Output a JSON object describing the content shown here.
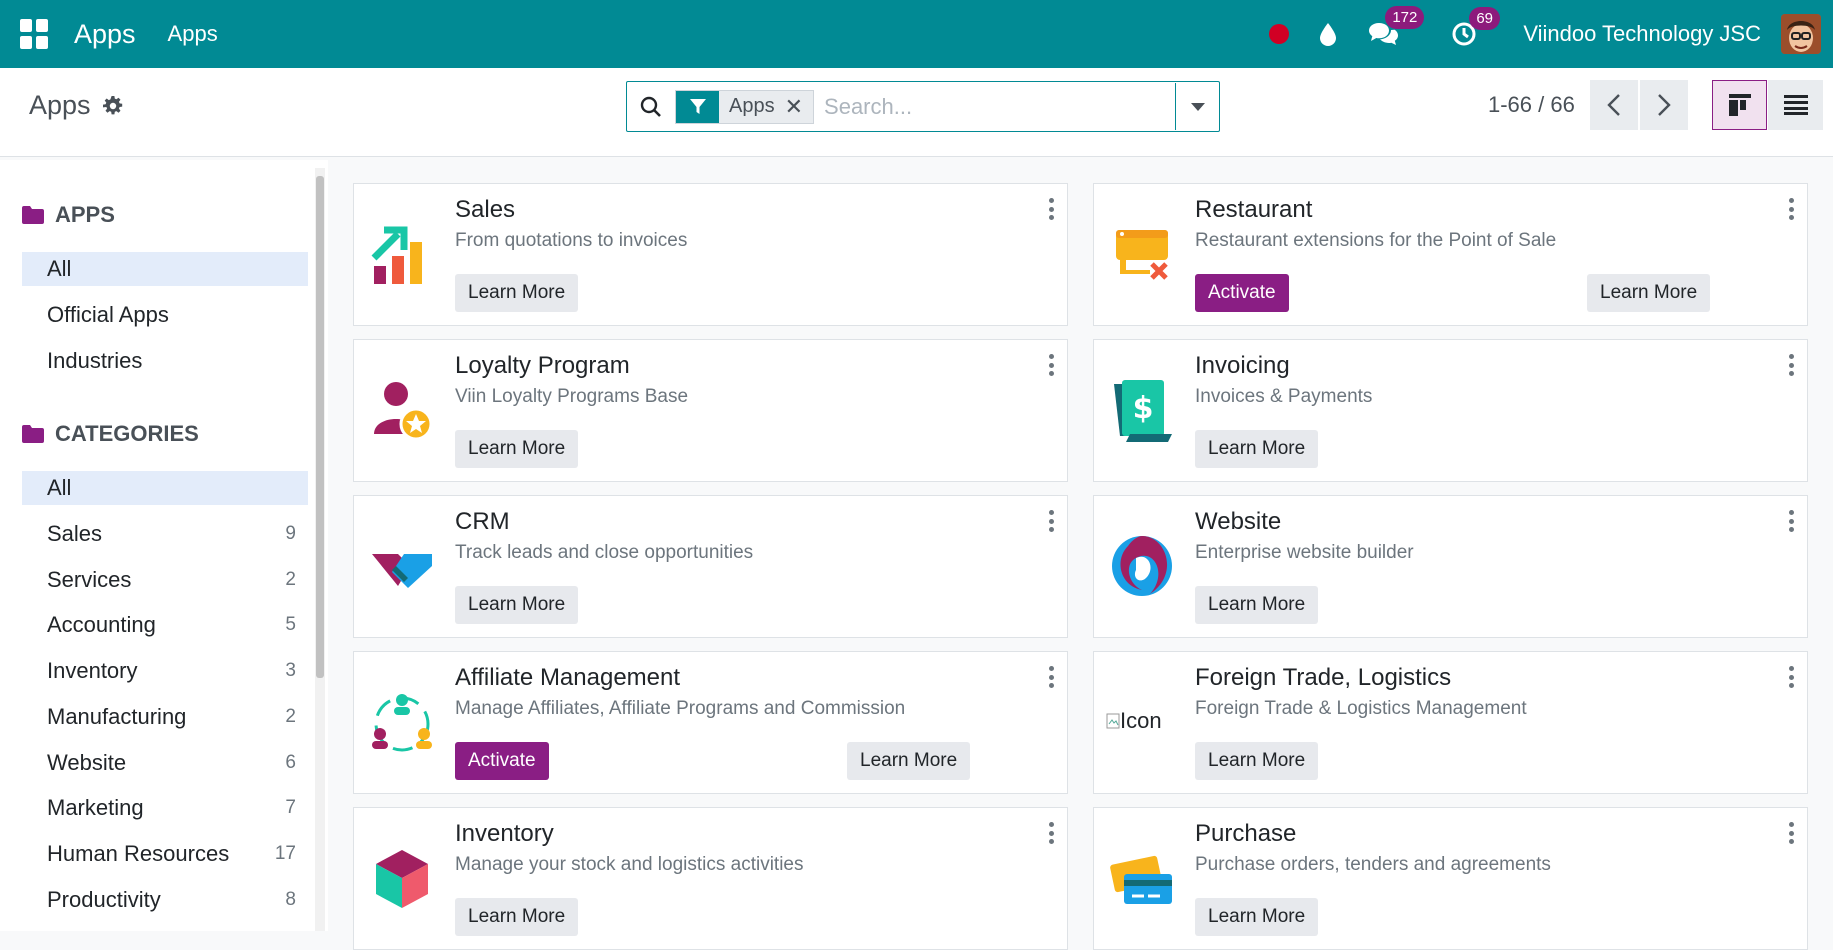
{
  "navbar": {
    "brand": "Apps",
    "menu_item": "Apps",
    "messages_badge": "172",
    "activities_badge": "69",
    "company": "Viindoo Technology JSC"
  },
  "control_panel": {
    "title": "Apps",
    "facet_label": "Apps",
    "search_placeholder": "Search...",
    "pager": "1-66 / 66"
  },
  "sidebar": {
    "apps_header": "APPS",
    "apps_items": [
      "All",
      "Official Apps",
      "Industries"
    ],
    "categories_header": "CATEGORIES",
    "categories": [
      {
        "label": "All",
        "count": ""
      },
      {
        "label": "Sales",
        "count": "9"
      },
      {
        "label": "Services",
        "count": "2"
      },
      {
        "label": "Accounting",
        "count": "5"
      },
      {
        "label": "Inventory",
        "count": "3"
      },
      {
        "label": "Manufacturing",
        "count": "2"
      },
      {
        "label": "Website",
        "count": "6"
      },
      {
        "label": "Marketing",
        "count": "7"
      },
      {
        "label": "Human Resources",
        "count": "17"
      },
      {
        "label": "Productivity",
        "count": "8"
      }
    ]
  },
  "buttons": {
    "learn_more": "Learn More",
    "activate": "Activate"
  },
  "cards": [
    {
      "title": "Sales",
      "subtitle": "From quotations to invoices",
      "icon": "sales-chart-icon"
    },
    {
      "title": "Restaurant",
      "subtitle": "Restaurant extensions for the Point of Sale",
      "icon": "restaurant-icon"
    },
    {
      "title": "Loyalty Program",
      "subtitle": "Viin Loyalty Programs Base",
      "icon": "loyalty-icon"
    },
    {
      "title": "Invoicing",
      "subtitle": "Invoices & Payments",
      "icon": "invoice-icon"
    },
    {
      "title": "CRM",
      "subtitle": "Track leads and close opportunities",
      "icon": "crm-handshake-icon"
    },
    {
      "title": "Website",
      "subtitle": "Enterprise website builder",
      "icon": "website-icon"
    },
    {
      "title": "Affiliate Management",
      "subtitle": "Manage Affiliates, Affiliate Programs and Commission",
      "icon": "affiliate-icon"
    },
    {
      "title": "Foreign Trade, Logistics",
      "subtitle": "Foreign Trade & Logistics Management",
      "icon": "broken-image-icon",
      "alt_text": "Icon"
    },
    {
      "title": "Inventory",
      "subtitle": "Manage your stock and logistics activities",
      "icon": "inventory-box-icon"
    },
    {
      "title": "Purchase",
      "subtitle": "Purchase orders, tenders and agreements",
      "icon": "purchase-cards-icon"
    }
  ]
}
